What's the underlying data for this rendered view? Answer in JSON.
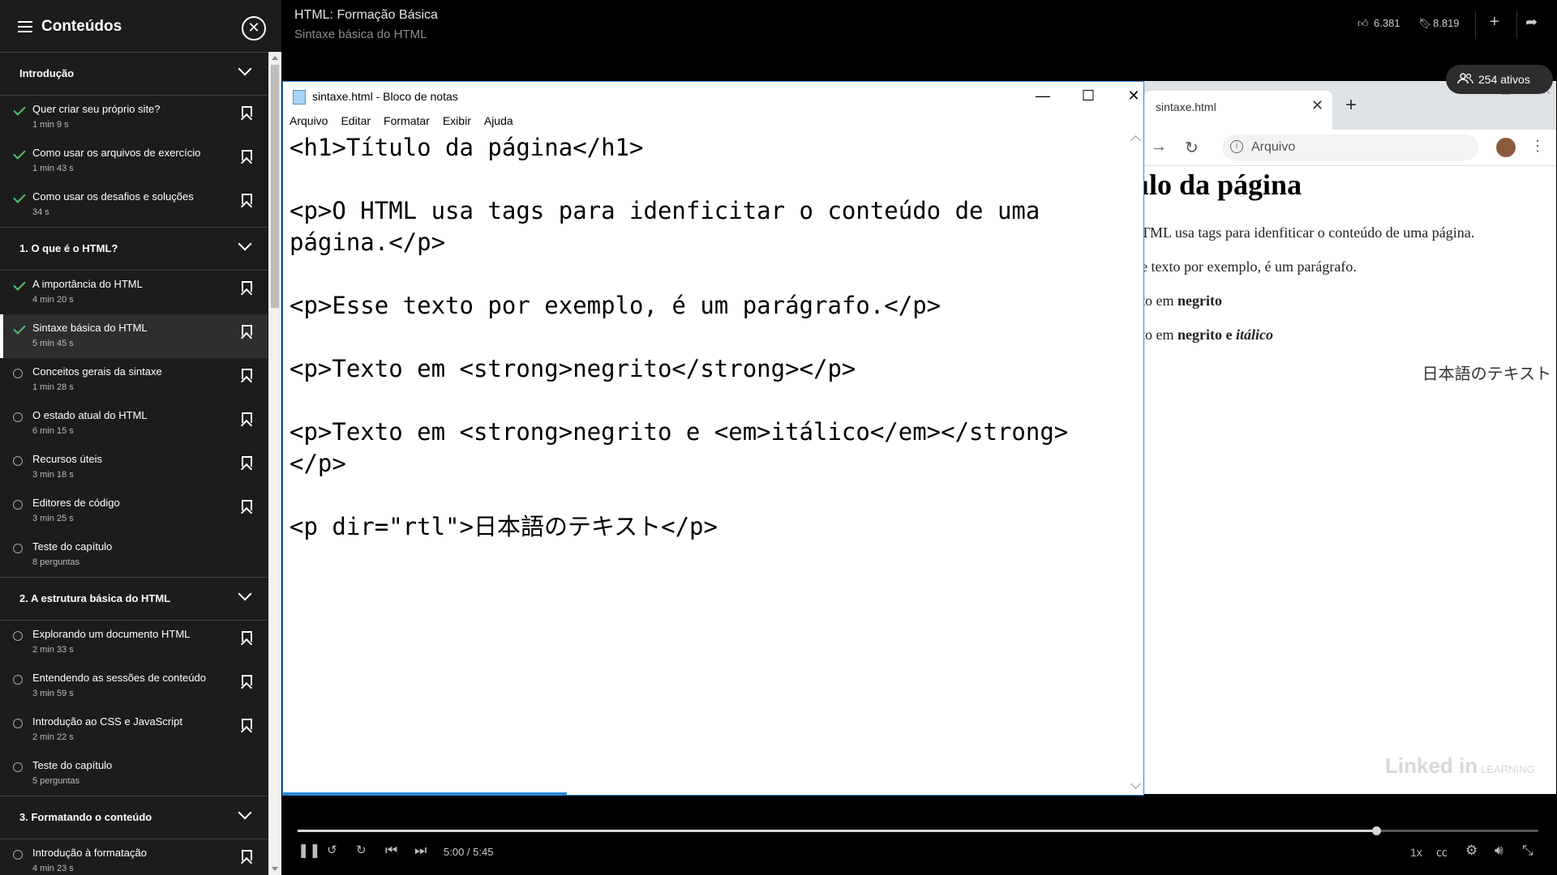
{
  "sidebar": {
    "title": "Conteúdos",
    "sections": [
      {
        "label": "Introdução",
        "items": [
          {
            "title": "Quer criar seu próprio site?",
            "duration": "1 min 9 s",
            "status": "done",
            "active": false
          },
          {
            "title": "Como usar os arquivos de exercício",
            "duration": "1 min 43 s",
            "status": "done",
            "active": false
          },
          {
            "title": "Como usar os desafios e soluções",
            "duration": "34 s",
            "status": "done",
            "active": false
          }
        ]
      },
      {
        "label": "1. O que é o HTML?",
        "items": [
          {
            "title": "A importância do HTML",
            "duration": "4 min 20 s",
            "status": "done",
            "active": false
          },
          {
            "title": "Sintaxe básica do HTML",
            "duration": "5 min 45 s",
            "status": "done",
            "active": true
          },
          {
            "title": "Conceitos gerais da sintaxe",
            "duration": "1 min 28 s",
            "status": "open",
            "active": false
          },
          {
            "title": "O estado atual do HTML",
            "duration": "6 min 15 s",
            "status": "open",
            "active": false
          },
          {
            "title": "Recursos úteis",
            "duration": "3 min 18 s",
            "status": "open",
            "active": false
          },
          {
            "title": "Editores de código",
            "duration": "3 min 25 s",
            "status": "open",
            "active": false
          },
          {
            "title": "Teste do capítulo",
            "duration": "8 perguntas",
            "status": "open",
            "active": false,
            "quiz": true
          }
        ]
      },
      {
        "label": "2. A estrutura básica do HTML",
        "items": [
          {
            "title": "Explorando um documento HTML",
            "duration": "2 min 33 s",
            "status": "open",
            "active": false
          },
          {
            "title": "Entendendo as sessões de conteúdo",
            "duration": "3 min 59 s",
            "status": "open",
            "active": false
          },
          {
            "title": "Introdução ao CSS e JavaScript",
            "duration": "2 min 22 s",
            "status": "open",
            "active": false
          },
          {
            "title": "Teste do capítulo",
            "duration": "5 perguntas",
            "status": "open",
            "active": false,
            "quiz": true
          }
        ]
      },
      {
        "label": "3. Formatando o conteúdo",
        "items": [
          {
            "title": "Introdução à formatação",
            "duration": "4 min 23 s",
            "status": "open",
            "active": false
          }
        ]
      }
    ]
  },
  "header": {
    "course_title": "HTML: Formação Básica",
    "lesson_title": "Sintaxe básica do HTML",
    "likes": "6.381",
    "saves": "8.819"
  },
  "active_users": "254 ativos",
  "notepad": {
    "title": "sintaxe.html - Bloco de notas",
    "menu": [
      "Arquivo",
      "Editar",
      "Formatar",
      "Exibir",
      "Ajuda"
    ],
    "content": "<h1>Título da página</h1>\n\n<p>O HTML usa tags para idenficitar o conteúdo de uma página.</p>\n\n<p>Esse texto por exemplo, é um parágrafo.</p>\n\n<p>Texto em <strong>negrito</strong></p>\n\n<p>Texto em <strong>negrito e <em>itálico</em></strong></p>\n\n<p dir=\"rtl\">日本語のテキスト</p>"
  },
  "browser": {
    "tab_title": "sintaxe.html",
    "address_label": "Arquivo",
    "page": {
      "h1": "ítulo da página",
      "p1": "TML usa tags para idenfiticar o conteúdo de uma página.",
      "p2": "e texto por exemplo, é um parágrafo.",
      "p3_prefix": "to em ",
      "p3_bold": "negrito",
      "p4_prefix": "to em ",
      "p4_bold": "negrito e ",
      "p4_italic": "itálico",
      "rtl": "日本語のテキスト"
    }
  },
  "watermark": {
    "brand": "Linked in",
    "suffix": "LEARNING"
  },
  "player": {
    "time": "5:00 / 5:45",
    "progress": 0.869,
    "speed": "1x"
  }
}
